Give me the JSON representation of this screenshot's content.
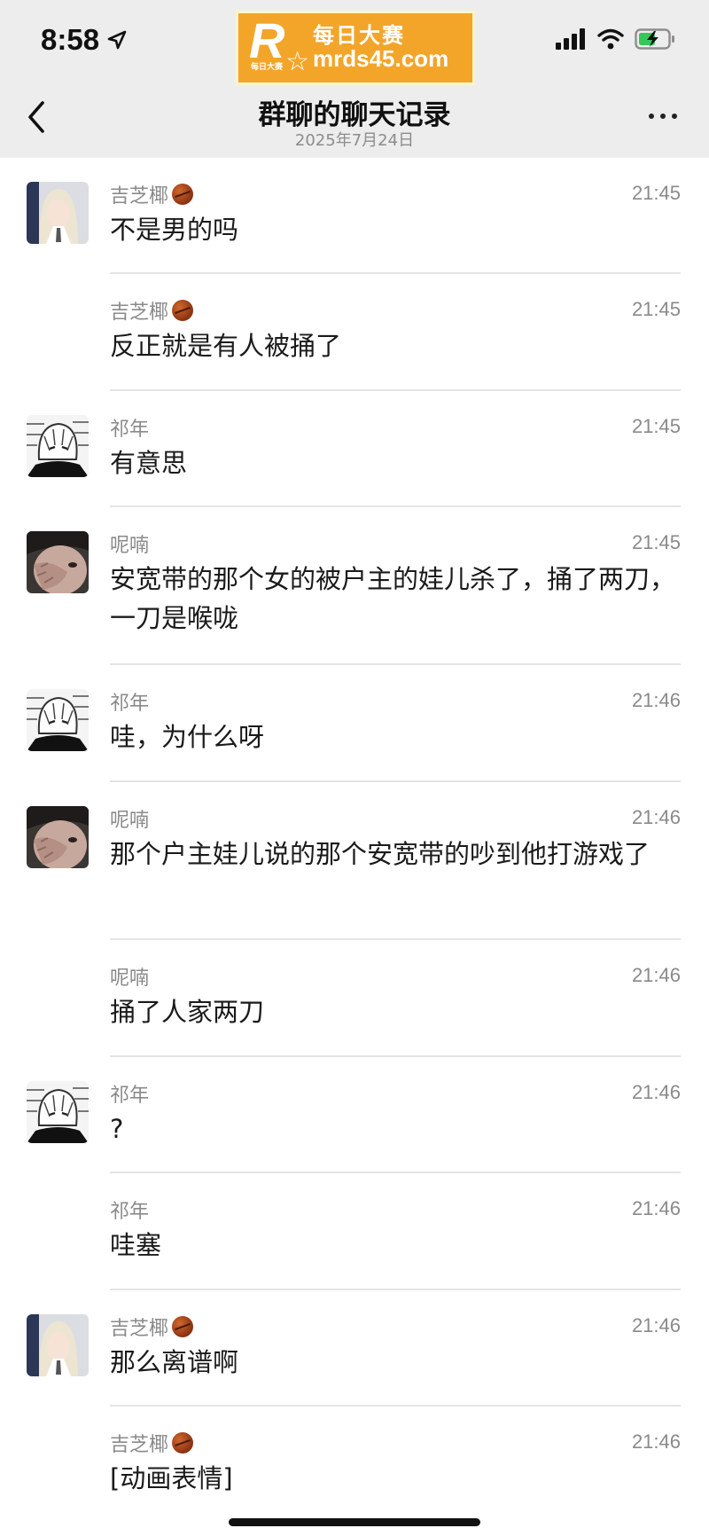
{
  "status_bar": {
    "time": "8:58"
  },
  "watermark": {
    "title": "每日大赛",
    "url": "mrds45.com",
    "logo_letter": "R",
    "logo_small": "每日大赛"
  },
  "header": {
    "title": "群聊的聊天记录",
    "date": "2025年7月24日"
  },
  "messages": [
    {
      "sender": "吉芝椰",
      "time": "21:45",
      "text": "不是男的吗"
    },
    {
      "sender": "吉芝椰",
      "time": "21:45",
      "text": "反正就是有人被捅了"
    },
    {
      "sender": "祁年",
      "time": "21:45",
      "text": "有意思"
    },
    {
      "sender": "呢喃",
      "time": "21:45",
      "text": "安宽带的那个女的被户主的娃儿杀了，捅了两刀，一刀是喉咙"
    },
    {
      "sender": "祁年",
      "time": "21:46",
      "text": "哇，为什么呀"
    },
    {
      "sender": "呢喃",
      "time": "21:46",
      "text": "那个户主娃儿说的那个安宽带的吵到他打游戏了"
    },
    {
      "sender": "呢喃",
      "time": "21:46",
      "text": "捅了人家两刀"
    },
    {
      "sender": "祁年",
      "time": "21:46",
      "text": "?"
    },
    {
      "sender": "祁年",
      "time": "21:46",
      "text": "哇塞"
    },
    {
      "sender": "吉芝椰",
      "time": "21:46",
      "text": "那么离谱啊"
    },
    {
      "sender": "吉芝椰",
      "time": "21:46",
      "text": "[动画表情]"
    }
  ]
}
